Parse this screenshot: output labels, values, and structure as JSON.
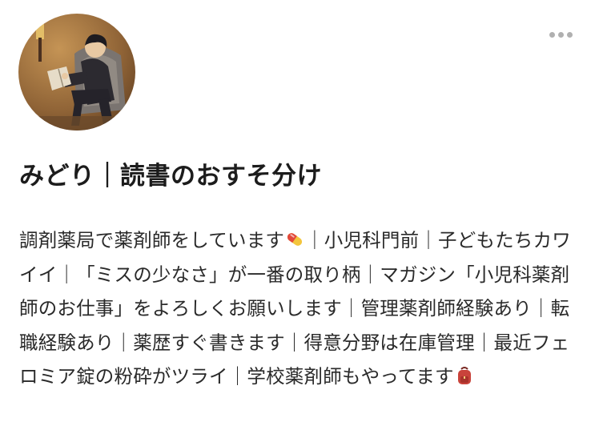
{
  "profile": {
    "display_name": "みどり｜読書のおすそ分け",
    "bio_segments": [
      "調剤薬局で薬剤師をしています",
      "｜小児科門前｜子どもたちカワイイ｜「ミスの少なさ」が一番の取り柄｜マガジン「小児科薬剤師のお仕事」をよろしくお願いします｜管理薬剤師経験あり｜転職経験あり｜薬歴すぐ書きます｜得意分野は在庫管理｜最近フェロミア錠の粉砕がツライ｜学校薬剤師もやってます"
    ],
    "bio_emojis": [
      "pill-emoji",
      "backpack-emoji"
    ]
  },
  "toolbar": {
    "more_icon": "more-horizontal-icon"
  },
  "colors": {
    "text": "#2a2a2a",
    "name_text": "#1c1c1c",
    "more_dots": "#b0b0b0",
    "pill_red": "#e2483b",
    "pill_yellow": "#f3c53d",
    "backpack_red": "#c9433b"
  }
}
